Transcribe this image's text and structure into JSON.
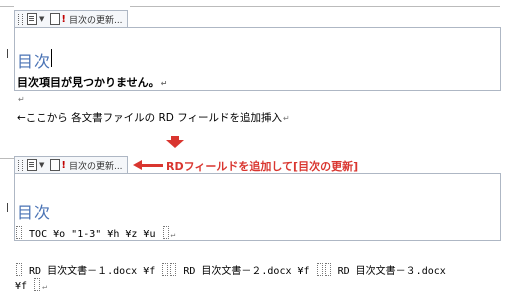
{
  "toc_block_1": {
    "update_button": "目次の更新...",
    "heading": "目次",
    "message": "目次項目が見つかりません。"
  },
  "instruction": "←ここから 各文書ファイルの RD フィールドを追加挿入",
  "callout": "RDフィールドを追加して[目次の更新]",
  "toc_block_2": {
    "update_button": "目次の更新...",
    "heading": "目次",
    "field_code": "TOC ¥o \"1-3\" ¥h ¥z ¥u"
  },
  "rd_fields": {
    "line1": "RD 目次文書－１.docx ¥f",
    "line2": "RD 目次文書－２.docx ¥f",
    "line3": "RD 目次文書－３.docx",
    "line3_cont": "¥f"
  },
  "colors": {
    "accent_red": "#d9352f",
    "heading_blue": "#4a73b5",
    "control_border": "#aeb7c4"
  },
  "icons": [
    "grip-icon",
    "document-icon",
    "dropdown-caret-icon",
    "update-table-icon",
    "return-mark-icon"
  ]
}
